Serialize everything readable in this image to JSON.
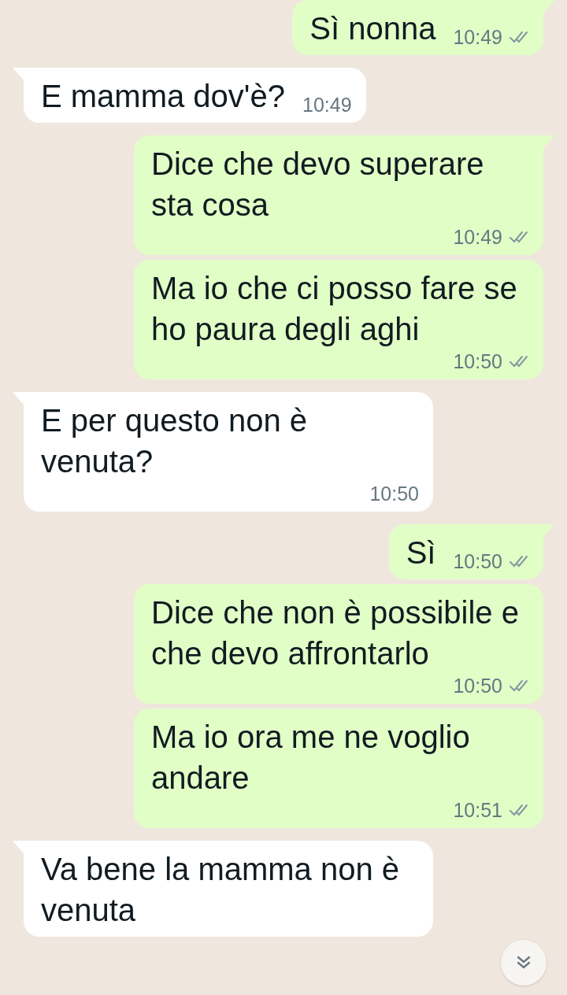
{
  "messages": [
    {
      "outgoing": true,
      "tail": true,
      "text": "Sì nonna",
      "time": "10:49",
      "read": false
    },
    {
      "outgoing": false,
      "tail": true,
      "text": "E mamma dov'è?",
      "time": "10:49"
    },
    {
      "outgoing": true,
      "tail": true,
      "text": "Dice che devo superare sta cosa",
      "time": "10:49",
      "read": false
    },
    {
      "outgoing": true,
      "tail": false,
      "text": "Ma io che ci posso fare se ho paura degli aghi",
      "time": "10:50",
      "read": false
    },
    {
      "outgoing": false,
      "tail": true,
      "text": "E per questo non è venuta?",
      "time": "10:50"
    },
    {
      "outgoing": true,
      "tail": true,
      "text": "Sì",
      "time": "10:50",
      "read": false
    },
    {
      "outgoing": true,
      "tail": false,
      "text": "Dice che non è possibile e che devo affrontarlo",
      "time": "10:50",
      "read": false
    },
    {
      "outgoing": true,
      "tail": false,
      "text": "Ma io ora me ne voglio andare",
      "time": "10:51",
      "read": false
    },
    {
      "outgoing": false,
      "tail": true,
      "text": "Va bene la mamma non è venuta"
    }
  ]
}
